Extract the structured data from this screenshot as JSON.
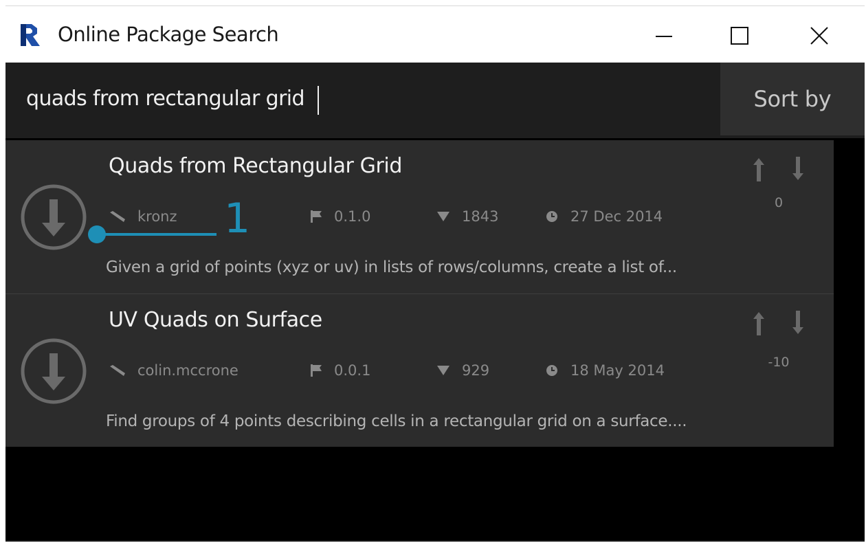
{
  "window": {
    "title": "Online Package Search",
    "icon": "revit-r-icon"
  },
  "search": {
    "query": "quads from rectangular grid",
    "sort_label": "Sort by"
  },
  "results": [
    {
      "title": "Quads from Rectangular Grid",
      "author": "kronz",
      "version": "0.1.0",
      "downloads": "1843",
      "date": "27 Dec 2014",
      "votes": "0",
      "description": "Given a grid of points (xyz or uv) in lists of rows/columns, create a list of..."
    },
    {
      "title": "UV Quads on Surface",
      "author": "colin.mccrone",
      "version": "0.0.1",
      "downloads": "929",
      "date": "18 May 2014",
      "votes": "-10",
      "description": "Find groups of 4 points describing cells in a rectangular grid on a surface...."
    }
  ],
  "callout": {
    "number": "1",
    "color": "#1e8fb6"
  },
  "colors": {
    "background": "#000000",
    "search_bar": "#1e1e1e",
    "result_card": "#2c2c2c",
    "sort_button": "#2f2f2f"
  }
}
